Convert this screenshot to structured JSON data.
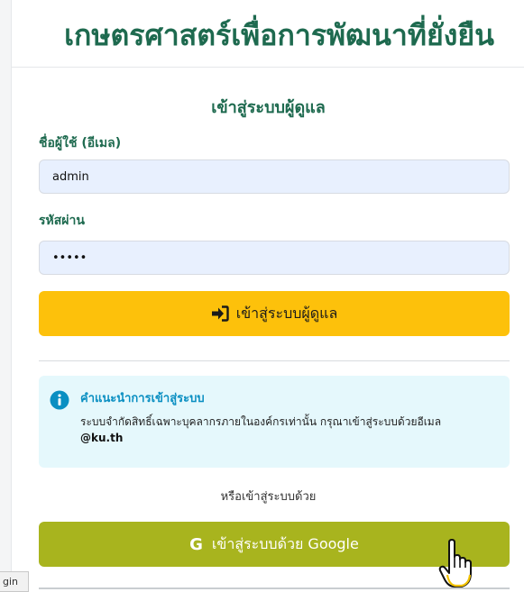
{
  "site": {
    "title": "เกษตรศาสตร์เพื่อการพัฒนาที่ยั่งยืน"
  },
  "login": {
    "heading": "เข้าสู่ระบบผู้ดูแล",
    "username_label": "ชื่อผู้ใช้ (อีเมล)",
    "username_value": "admin",
    "password_label": "รหัสผ่าน",
    "password_value": "admin",
    "submit_label": "เข้าสู่ระบบผู้ดูแล"
  },
  "notice": {
    "title": "คำแนะนำการเข้าสู่ระบบ",
    "text": "ระบบจำกัดสิทธิ์เฉพาะบุคลากรภายในองค์กรเท่านั้น กรุณาเข้าสู่ระบบด้วยอีเมล",
    "domain": "@ku.th"
  },
  "alt_login": {
    "or_text": "หรือเข้าสู่ระบบด้วย",
    "google_letter": "G",
    "google_label": "เข้าสู่ระบบด้วย Google"
  },
  "status_bar": {
    "text": "gin"
  },
  "colors": {
    "title_green": "#1e6a4f",
    "login_yellow": "#fdc10b",
    "google_olive": "#a8b41e",
    "info_bg": "#e5f8fc",
    "info_blue": "#0a8fc2"
  },
  "icons": {
    "login": "sign-in-icon",
    "info": "info-circle-icon",
    "cursor": "hand-pointer-icon"
  }
}
